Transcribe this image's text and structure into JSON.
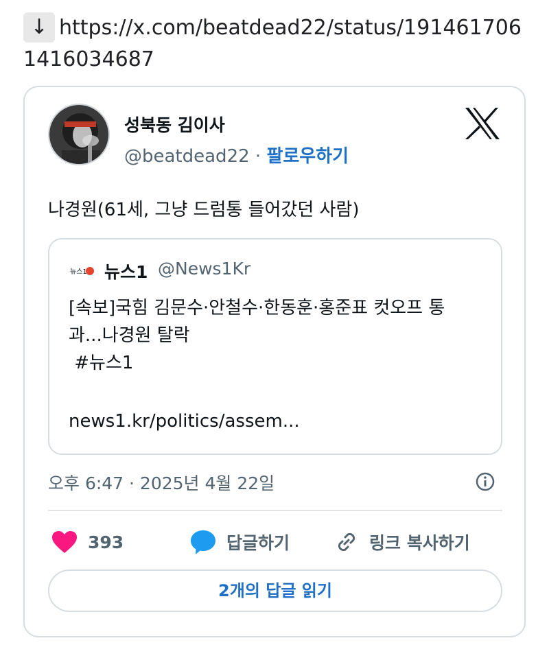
{
  "url_bar": {
    "arrow": "↓",
    "url": "https://x.com/beatdead22/status/1914617061416034687"
  },
  "tweet": {
    "author_name": "성북동 김이사",
    "handle": "@beatdead22",
    "separator": "·",
    "follow_label": "팔로우하기",
    "text": "나경원(61세, 그냥 드럼통 들어갔던 사람)",
    "quote": {
      "logo_text": "뉴스1",
      "name": "뉴스1",
      "handle": "@News1Kr",
      "lines": [
        "[속보]국힘 김문수·안철수·한동훈·홍준표 컷오프 통",
        "과...나경원 탈락",
        " #뉴스1"
      ],
      "link": "news1.kr/politics/assem..."
    },
    "timestamp": "오후 6:47 · 2025년 4월 22일",
    "likes": "393",
    "reply_label": "답글하기",
    "copy_link_label": "링크 복사하기",
    "read_replies_label": "2개의 답글 읽기"
  },
  "colors": {
    "heart": "#f91880",
    "reply_bubble": "#1d9bf0",
    "link_blue": "#1d6fc7",
    "muted": "#536471"
  },
  "icons": [
    "x-logo-icon",
    "info-icon",
    "heart-icon",
    "reply-bubble-icon",
    "link-icon"
  ]
}
